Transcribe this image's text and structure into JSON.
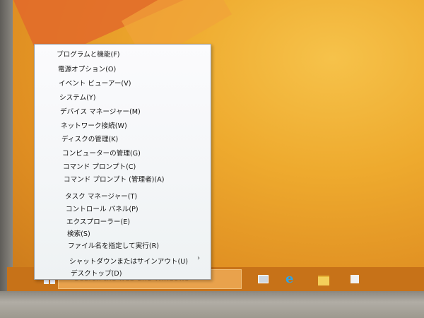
{
  "menu": {
    "items": [
      {
        "label": "プログラムと機能(F)"
      },
      {
        "label": "電源オプション(O)"
      },
      {
        "label": "イベント ビューアー(V)"
      },
      {
        "label": "システム(Y)"
      },
      {
        "label": "デバイス マネージャー(M)"
      },
      {
        "label": "ネットワーク接続(W)"
      },
      {
        "label": "ディスクの管理(K)"
      },
      {
        "label": "コンピューターの管理(G)"
      },
      {
        "label": "コマンド プロンプト(C)"
      },
      {
        "label": "コマンド プロンプト (管理者)(A)"
      },
      {
        "label": "タスク マネージャー(T)"
      },
      {
        "label": "コントロール パネル(P)"
      },
      {
        "label": "エクスプローラー(E)"
      },
      {
        "label": "検索(S)"
      },
      {
        "label": "ファイル名を指定して実行(R)"
      },
      {
        "label": "シャットダウンまたはサインアウト(U)"
      },
      {
        "label": "デスクトップ(D)"
      }
    ],
    "submenu_arrow": "›"
  },
  "taskbar": {
    "search_placeholder": "Search the web and Windows",
    "icons": [
      "windows-start-icon",
      "task-view-icon",
      "internet-explorer-icon",
      "file-explorer-icon",
      "store-icon"
    ],
    "ie_glyph": "e"
  },
  "colors": {
    "desktop": "#eeaa2e",
    "taskbar": "#c77218",
    "menu_background": "#f6f7f9"
  }
}
